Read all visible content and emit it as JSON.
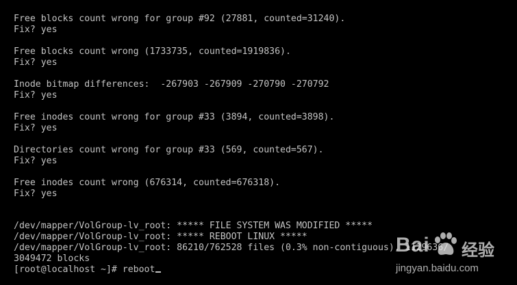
{
  "terminal": {
    "lines": [
      "Free blocks count wrong for group #92 (27881, counted=31240).",
      "Fix? yes",
      "",
      "Free blocks count wrong (1733735, counted=1919836).",
      "Fix? yes",
      "",
      "Inode bitmap differences:  -267903 -267909 -270790 -270792",
      "Fix? yes",
      "",
      "Free inodes count wrong for group #33 (3894, counted=3898).",
      "Fix? yes",
      "",
      "Directories count wrong for group #33 (569, counted=567).",
      "Fix? yes",
      "",
      "Free inodes count wrong (676314, counted=676318).",
      "Fix? yes",
      "",
      "",
      "/dev/mapper/VolGroup-lv_root: ***** FILE SYSTEM WAS MODIFIED *****",
      "/dev/mapper/VolGroup-lv_root: ***** REBOOT LINUX *****",
      "/dev/mapper/VolGroup-lv_root: 86210/762528 files (0.3% non-contiguous), 1129636/",
      "3049472 blocks"
    ],
    "prompt": "[root@localhost ~]# ",
    "command": "reboot",
    "colors": {
      "background": "#000000",
      "text": "#c4c4c4"
    }
  },
  "watermark": {
    "brand": "Bai",
    "brand_cn": "经验",
    "url": "jingyan.baidu.com",
    "icon": "paw-icon"
  }
}
